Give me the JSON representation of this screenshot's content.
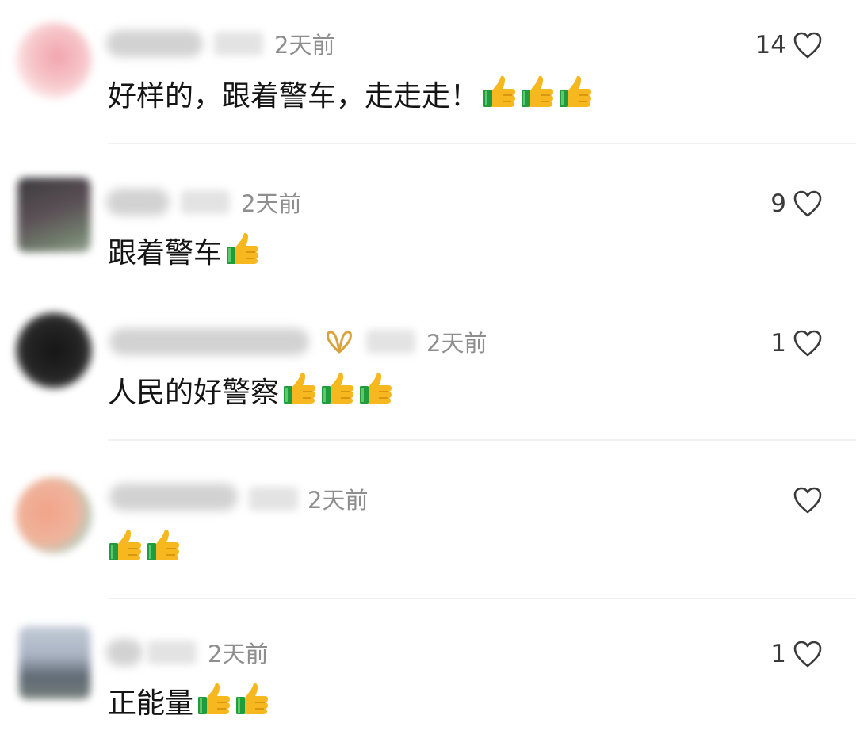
{
  "comments": [
    {
      "time": "2天前",
      "text": "好样的，跟着警车，走走走！",
      "thumbs": 3,
      "likes": "14"
    },
    {
      "time": "2天前",
      "text": "跟着警车",
      "thumbs": 1,
      "likes": "9"
    },
    {
      "time": "2天前",
      "text": "人民的好警察",
      "thumbs": 3,
      "likes": "1"
    },
    {
      "time": "2天前",
      "text": "",
      "thumbs": 2,
      "likes": ""
    },
    {
      "time": "2天前",
      "text": "正能量",
      "thumbs": 2,
      "likes": "1"
    }
  ],
  "icons": {
    "like": "heart-outline-icon",
    "reaction": "thumbs-up-emoji-icon",
    "badge": "gold-ribbon-badge-icon"
  },
  "colors": {
    "time": "#8e8e8e",
    "text": "#141414",
    "heart": "#3a3a3a",
    "thumb_yellow": "#f6b81e",
    "thumb_cuff": "#1f9c3b",
    "badge_gold": "#d9a23a"
  }
}
